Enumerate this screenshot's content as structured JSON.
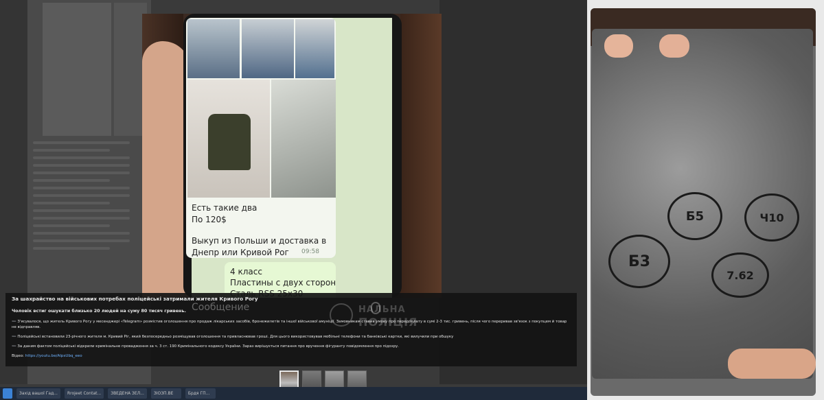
{
  "chat_image": {
    "messages": [
      {
        "lines": [
          "Есть такие два",
          "По 120$",
          "",
          "Выкуп из Польши и доставка в",
          "Днепр или Кривой Рог"
        ],
        "time": "09:58"
      },
      {
        "lines": [
          "4 класс",
          "Пластины с двух сторон",
          "Сталь RSS 25x30"
        ]
      }
    ],
    "input_placeholder": "Сообщение",
    "watermark": {
      "line1": "НАЛЬНА",
      "line2": "ПОЛІЦІЯ"
    }
  },
  "side_image": {
    "marks": [
      "Б5",
      "Ч10",
      "Б3",
      "7.62"
    ]
  },
  "caption": {
    "title": "За шахрайство на військових потребах поліцейські затримали жителя Кривого Рогу",
    "subtitle": "Чоловік встиг ошукати близько 20 людей на суму 80 тисяч гривень.",
    "paragraphs": [
      "➖ З'ясувалося, що житель Кривого Рогу у месенджері «Telegram» розмістив оголошення про продаж лікарських засобів, бронежилетів та іншої військової амуніції. Замовникам ставив умову про передоплату в сумі 2-3 тис. гривень, після чого переривав зв'язок з покупцем й товар не відправляв.",
      "➖ Поліцейські встановили 23-річного жителя м. Кривий Ріг, який безпосередньо розміщував оголошення та привласнював гроші. Для цього використовував мобільні телефони та банківські картки, які вилучили при обшуку",
      "➖ За даним фактом поліцейські відкрили кримінальне провадження за ч. 3 ст. 190 Кримінального кодексу України. Зараз вирішується питання про вручення фігуранту повідомлення про підозру."
    ],
    "video_label": "Відео:",
    "video_link": "https://youtu.be/AlpsUbq_eeo"
  },
  "thumbnails": [
    {
      "name": "thumb-1",
      "active": true
    },
    {
      "name": "thumb-2",
      "active": false
    },
    {
      "name": "thumb-3",
      "active": false
    },
    {
      "name": "thumb-4",
      "active": false
    }
  ],
  "taskbar": {
    "items": [
      "Захід вашої Гад...",
      "Rrojeet Contat...",
      "ЗВЕДЕНА ЗЕЛ...",
      "ЗІОЗП.ВЕ",
      "Брдя ГП..."
    ]
  },
  "colors": {
    "caption_bg": "#141414",
    "link": "#6fb3ff",
    "taskbar": "#1f2a3a"
  }
}
